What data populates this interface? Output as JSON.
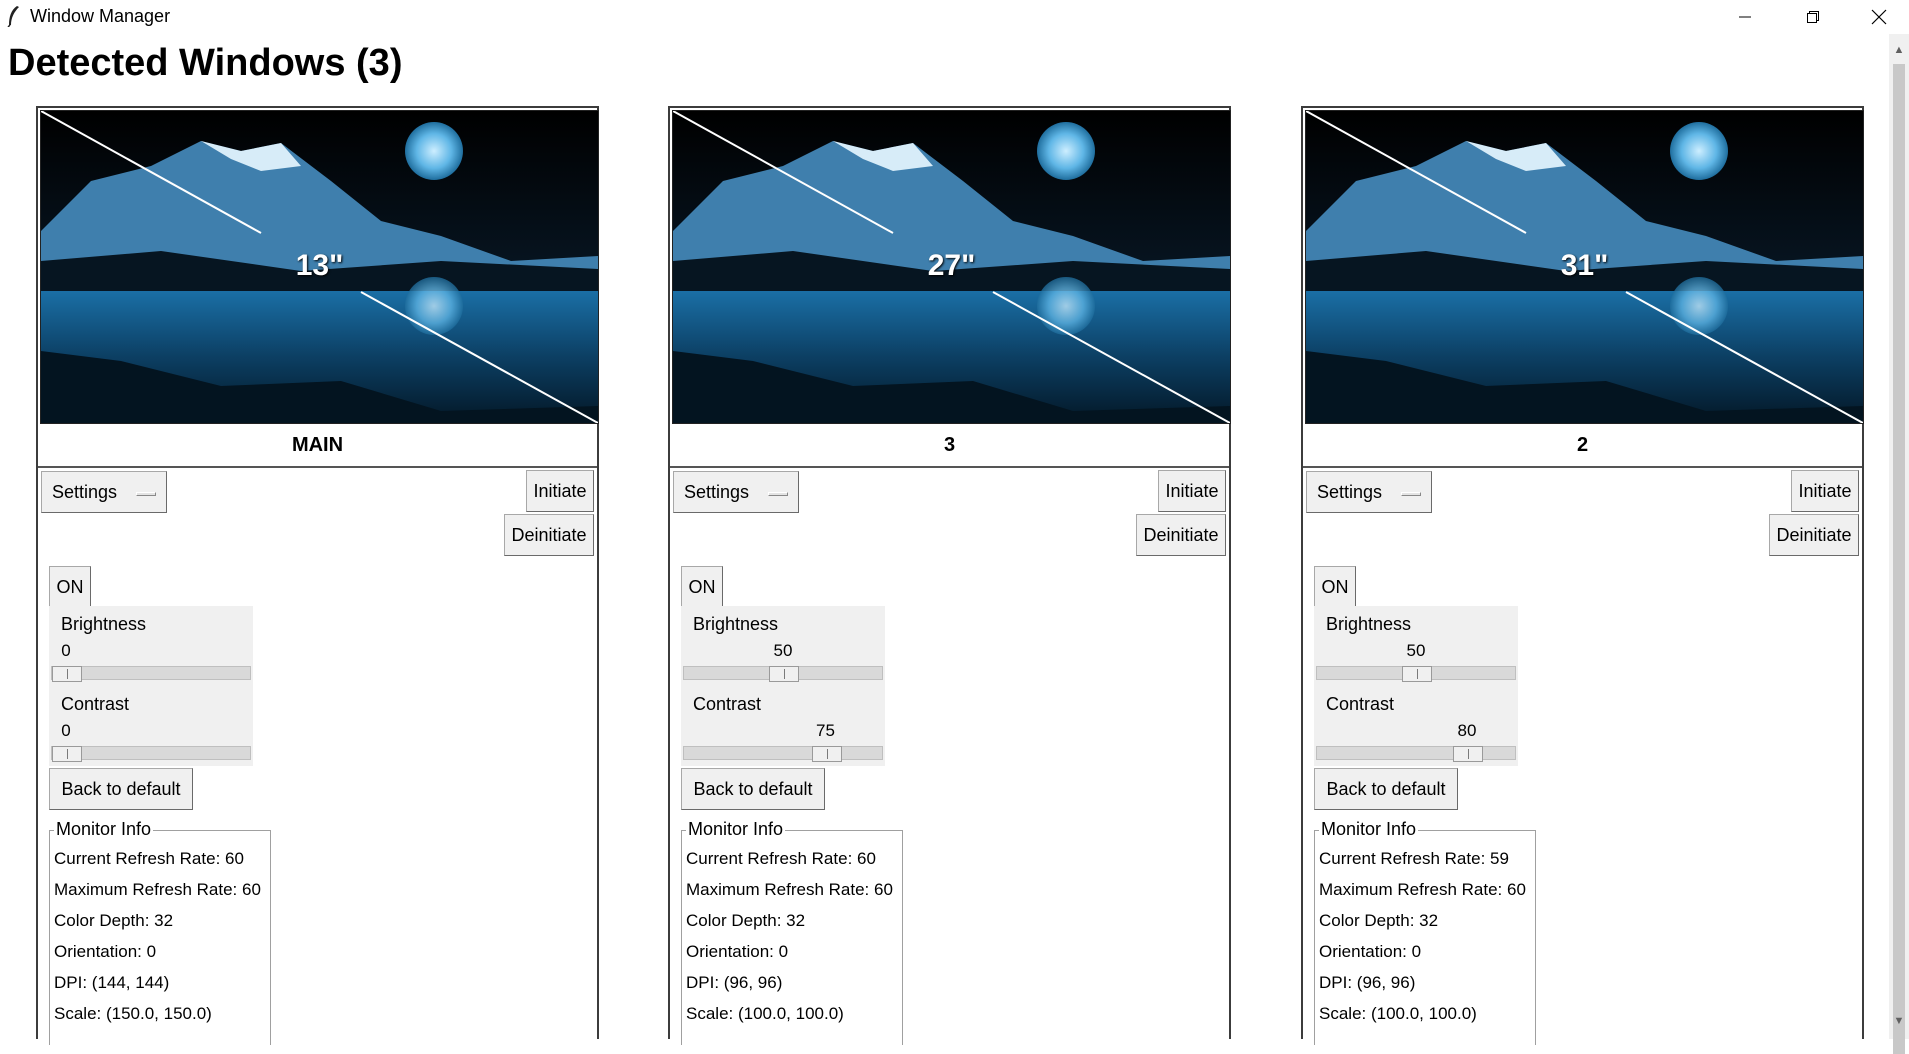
{
  "window": {
    "title": "Window Manager",
    "minimize_icon": "minimize-icon",
    "maximize_icon": "restore-icon",
    "close_icon": "close-icon"
  },
  "heading": "Detected Windows (3)",
  "panels": [
    {
      "size": "13\"",
      "name": "MAIN",
      "settings_label": "Settings",
      "initiate_label": "Initiate",
      "deinitiate_label": "Deinitiate",
      "on_label": "ON",
      "brightness": {
        "label": "Brightness",
        "value": "0",
        "fraction": 0
      },
      "contrast": {
        "label": "Contrast",
        "value": "0",
        "fraction": 0
      },
      "default_label": "Back to default",
      "info_title": "Monitor Info",
      "info": [
        "Current Refresh Rate: 60",
        "Maximum Refresh Rate: 60",
        "Color Depth: 32",
        "Orientation: 0",
        "DPI: (144, 144)",
        "Scale: (150.0, 150.0)"
      ]
    },
    {
      "size": "27\"",
      "name": "3",
      "settings_label": "Settings",
      "initiate_label": "Initiate",
      "deinitiate_label": "Deinitiate",
      "on_label": "ON",
      "brightness": {
        "label": "Brightness",
        "value": "50",
        "fraction": 0.5
      },
      "contrast": {
        "label": "Contrast",
        "value": "75",
        "fraction": 0.75
      },
      "default_label": "Back to default",
      "info_title": "Monitor Info",
      "info": [
        "Current Refresh Rate: 60",
        "Maximum Refresh Rate: 60",
        "Color Depth: 32",
        "Orientation: 0",
        "DPI: (96, 96)",
        "Scale: (100.0, 100.0)"
      ]
    },
    {
      "size": "31\"",
      "name": "2",
      "settings_label": "Settings",
      "initiate_label": "Initiate",
      "deinitiate_label": "Deinitiate",
      "on_label": "ON",
      "brightness": {
        "label": "Brightness",
        "value": "50",
        "fraction": 0.5
      },
      "contrast": {
        "label": "Contrast",
        "value": "80",
        "fraction": 0.8
      },
      "default_label": "Back to default",
      "info_title": "Monitor Info",
      "info": [
        "Current Refresh Rate: 59",
        "Maximum Refresh Rate: 60",
        "Color Depth: 32",
        "Orientation: 0",
        "DPI: (96, 96)",
        "Scale: (100.0, 100.0)"
      ]
    }
  ]
}
